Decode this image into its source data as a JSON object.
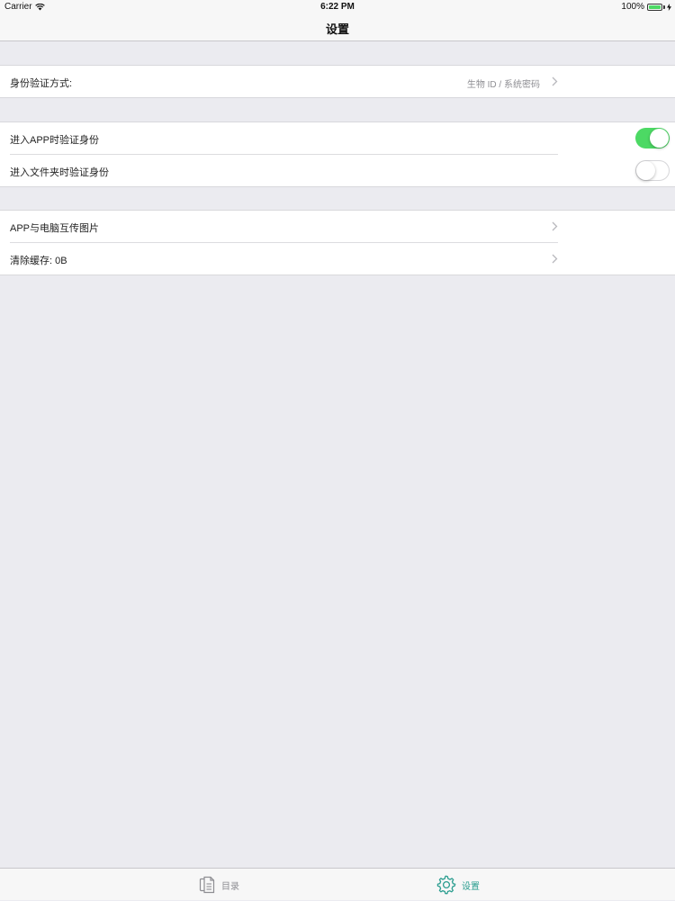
{
  "status_bar": {
    "carrier": "Carrier",
    "time": "6:22 PM",
    "battery": "100%",
    "battery_level": 1.0
  },
  "nav": {
    "title": "设置"
  },
  "sections": {
    "auth": {
      "method_label": "身份验证方式:",
      "method_value": "生物 ID / 系统密码"
    },
    "verify": {
      "app_label": "进入APP时验证身份",
      "app_enabled": true,
      "folder_label": "进入文件夹时验证身份",
      "folder_enabled": false
    },
    "other": {
      "transfer_label": "APP与电脑互传图片",
      "cache_label": "清除缓存: 0B"
    }
  },
  "tab_bar": {
    "tabs": [
      {
        "label": "目录",
        "icon": "document-icon",
        "selected": false
      },
      {
        "label": "设置",
        "icon": "gear-icon",
        "selected": true
      }
    ]
  },
  "colors": {
    "accent": "#2a9d8f",
    "toggle_on": "#4cd964",
    "background": "#ebebf0"
  }
}
